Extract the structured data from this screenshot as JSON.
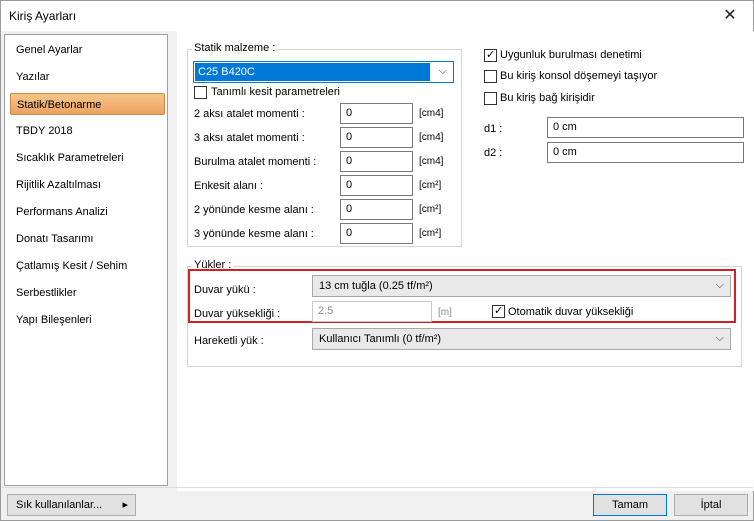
{
  "window": {
    "title": "Kiriş Ayarları",
    "close_glyph": "✕"
  },
  "sidebar": {
    "items": [
      {
        "label": "Genel Ayarlar"
      },
      {
        "label": "Yazılar"
      },
      {
        "label": "Statik/Betonarme"
      },
      {
        "label": "TBDY 2018"
      },
      {
        "label": "Sıcaklık Parametreleri"
      },
      {
        "label": "Rijitlik Azaltılması"
      },
      {
        "label": "Performans Analizi"
      },
      {
        "label": "Donatı Tasarımı"
      },
      {
        "label": "Çatlamış Kesit / Sehim"
      },
      {
        "label": "Serbestlikler"
      },
      {
        "label": "Yapı Bileşenleri"
      }
    ],
    "active_index": 2
  },
  "statik": {
    "group_label": "Statik malzeme :",
    "material": "C25 B420C",
    "custom_section_label": "Tanımlı kesit parametreleri",
    "custom_section_checked": false,
    "fields": [
      {
        "label": "2 aksı atalet momenti :",
        "value": "0",
        "unit": "[cm4]"
      },
      {
        "label": "3 aksı atalet momenti :",
        "value": "0",
        "unit": "[cm4]"
      },
      {
        "label": "Burulma atalet momenti :",
        "value": "0",
        "unit": "[cm4]"
      },
      {
        "label": "Enkesit alanı :",
        "value": "0",
        "unit": "[cm²]"
      },
      {
        "label": "2 yönünde kesme alanı :",
        "value": "0",
        "unit": "[cm²]"
      },
      {
        "label": "3 yönünde kesme alanı :",
        "value": "0",
        "unit": "[cm²]"
      }
    ]
  },
  "right": {
    "checks": [
      {
        "label": "Uygunluk burulması denetimi",
        "checked": true
      },
      {
        "label": "Bu kiriş konsol döşemeyi taşıyor",
        "checked": false
      },
      {
        "label": "Bu kiriş bağ kirişidir",
        "checked": false
      }
    ],
    "d1_label": "d1 :",
    "d1_value": "0 cm",
    "d2_label": "d2 :",
    "d2_value": "0 cm"
  },
  "loads": {
    "group_label": "Yükler :",
    "wall_load_label": "Duvar yükü :",
    "wall_load_value": "13 cm tuğla (0.25 tf/m²)",
    "wall_height_label": "Duvar yüksekliği :",
    "wall_height_value": "2.5",
    "wall_height_unit": "[m]",
    "auto_height_label": "Otomatik duvar yüksekliği",
    "auto_height_checked": true,
    "live_load_label": "Hareketli yük :",
    "live_load_value": "Kullanıcı Tanımlı (0 tf/m²)"
  },
  "footer": {
    "favorites_label": "Sık kullanılanlar...",
    "favorites_arrow": "▸",
    "ok_label": "Tamam",
    "cancel_label": "İptal"
  },
  "colors": {
    "highlight": "#d21f2a",
    "accent": "#0078d7",
    "active_item": "#eca260"
  }
}
